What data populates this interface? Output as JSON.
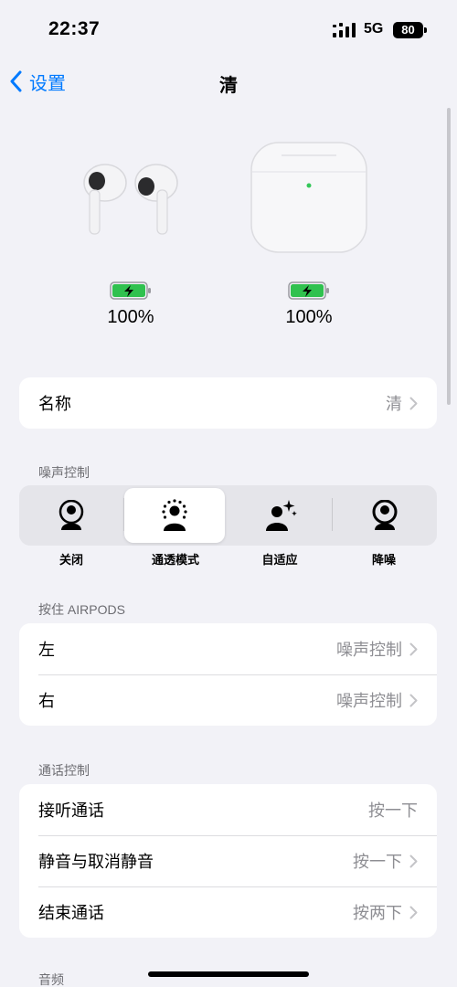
{
  "status": {
    "time": "22:37",
    "network": "5G",
    "battery": "80"
  },
  "nav": {
    "back_label": "设置",
    "title": "清"
  },
  "devices": {
    "earbuds": {
      "battery_pct": "100%",
      "battery_level": 1.0
    },
    "case": {
      "battery_pct": "100%",
      "battery_level": 1.0
    }
  },
  "name_row": {
    "label": "名称",
    "value": "清"
  },
  "noise_control": {
    "header": "噪声控制",
    "selected_index": 1,
    "options": [
      {
        "label": "关闭",
        "icon": "person-off-icon"
      },
      {
        "label": "通透模式",
        "icon": "transparency-icon"
      },
      {
        "label": "自适应",
        "icon": "adaptive-icon"
      },
      {
        "label": "降噪",
        "icon": "noise-cancellation-icon"
      }
    ]
  },
  "press_hold": {
    "header": "按住 AIRPODS",
    "rows": [
      {
        "label": "左",
        "value": "噪声控制"
      },
      {
        "label": "右",
        "value": "噪声控制"
      }
    ]
  },
  "call_controls": {
    "header": "通话控制",
    "rows": [
      {
        "label": "接听通话",
        "value": "按一下"
      },
      {
        "label": "静音与取消静音",
        "value": "按一下"
      },
      {
        "label": "结束通话",
        "value": "按两下"
      }
    ]
  },
  "audio": {
    "header": "音频"
  },
  "colors": {
    "accent": "#007aff",
    "battery_green": "#30c14f",
    "background": "#f2f2f7"
  }
}
